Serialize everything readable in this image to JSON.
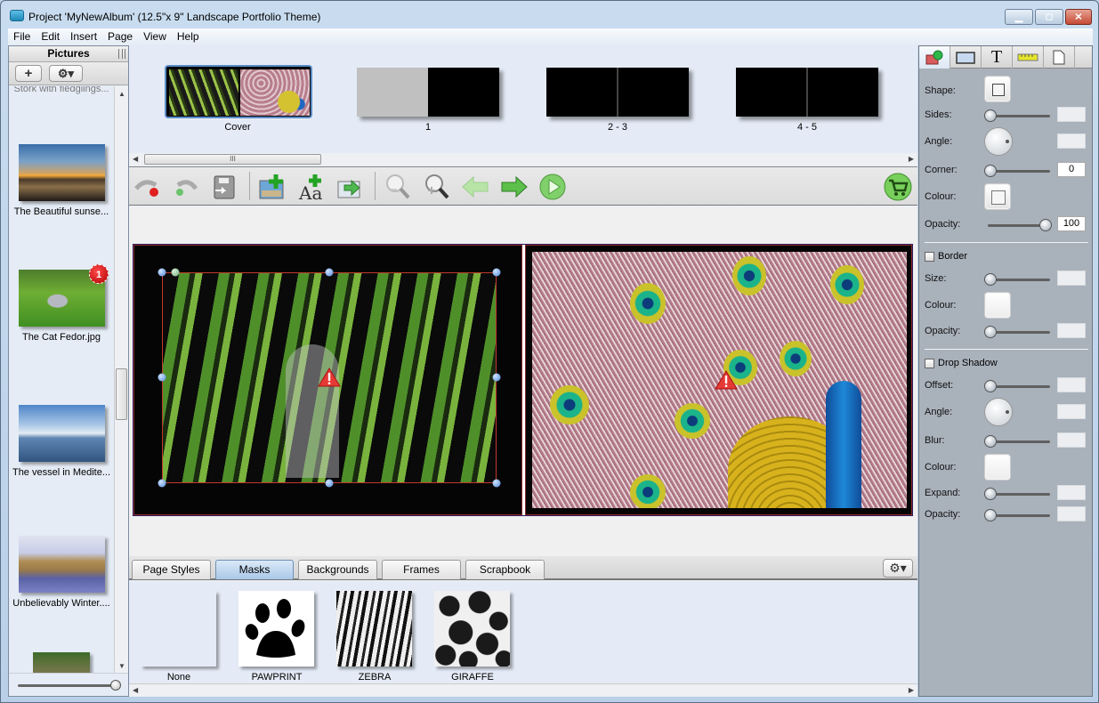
{
  "window": {
    "title": "Project 'MyNewAlbum' (12.5\"x 9\" Landscape Portfolio Theme)",
    "controls": {
      "minimize": "minimize",
      "maximize": "maximize",
      "close": "✕"
    }
  },
  "menu": [
    "File",
    "Edit",
    "Insert",
    "Page",
    "View",
    "Help"
  ],
  "sidebar": {
    "title": "Pictures",
    "add_button": "+",
    "settings_button": "⚙▾",
    "pictures": [
      {
        "label": "Stork with fledglings..."
      },
      {
        "label": "The Beautiful sunse..."
      },
      {
        "label": "The Cat Fedor.jpg",
        "badge": "1"
      },
      {
        "label": "The vessel in Medite..."
      },
      {
        "label": "Unbelievably Winter...."
      },
      {
        "label": ""
      }
    ],
    "thumbnail_size_slider": 1.0
  },
  "pages_strip": {
    "pages": [
      {
        "label": "Cover",
        "selected": true
      },
      {
        "label": "1"
      },
      {
        "label": "2 - 3"
      },
      {
        "label": "4 - 5"
      }
    ],
    "scroll_thumb": "III"
  },
  "toolbar": {
    "buttons": [
      {
        "name": "undo",
        "tooltip": "Undo"
      },
      {
        "name": "redo",
        "tooltip": "Redo"
      },
      {
        "name": "save",
        "tooltip": "Save"
      },
      {
        "name": "add-picture",
        "tooltip": "Add picture"
      },
      {
        "name": "add-text",
        "tooltip": "Add text"
      },
      {
        "name": "export",
        "tooltip": "Export"
      },
      {
        "name": "zoom-out",
        "tooltip": "Zoom out"
      },
      {
        "name": "zoom-in",
        "tooltip": "Zoom in"
      },
      {
        "name": "previous-page",
        "tooltip": "Previous"
      },
      {
        "name": "next-page",
        "tooltip": "Next"
      },
      {
        "name": "play",
        "tooltip": "Preview"
      },
      {
        "name": "cart",
        "tooltip": "Order"
      }
    ]
  },
  "bottom_tabs": {
    "tabs": [
      "Page Styles",
      "Masks",
      "Backgrounds",
      "Frames",
      "Scrapbook"
    ],
    "active": "Masks",
    "gear": "⚙▾"
  },
  "masks": [
    "None",
    "PAWPRINT",
    "ZEBRA",
    "GIRAFFE"
  ],
  "properties": {
    "tabs": [
      "shape-properties",
      "frame",
      "text",
      "ruler",
      "page"
    ],
    "shape": {
      "shape_label": "Shape:",
      "sides_label": "Sides:",
      "sides_value": "",
      "angle_label": "Angle:",
      "angle_value": "",
      "corner_label": "Corner:",
      "corner_value": "0",
      "colour_label": "Colour:",
      "opacity_label": "Opacity:",
      "opacity_value": "100"
    },
    "border": {
      "label": "Border",
      "checked": false,
      "size_label": "Size:",
      "size_value": "",
      "colour_label": "Colour:",
      "opacity_label": "Opacity:",
      "opacity_value": ""
    },
    "drop_shadow": {
      "label": "Drop Shadow",
      "checked": false,
      "offset_label": "Offset:",
      "offset_value": "",
      "angle_label": "Angle:",
      "angle_value": "",
      "blur_label": "Blur:",
      "blur_value": "",
      "colour_label": "Colour:",
      "expand_label": "Expand:",
      "expand_value": "",
      "opacity_label": "Opacity:",
      "opacity_value": ""
    }
  },
  "colors": {
    "accent": "#4d86d6",
    "selection": "#c0392b",
    "warning": "#e53935",
    "cart": "#4caf50"
  }
}
